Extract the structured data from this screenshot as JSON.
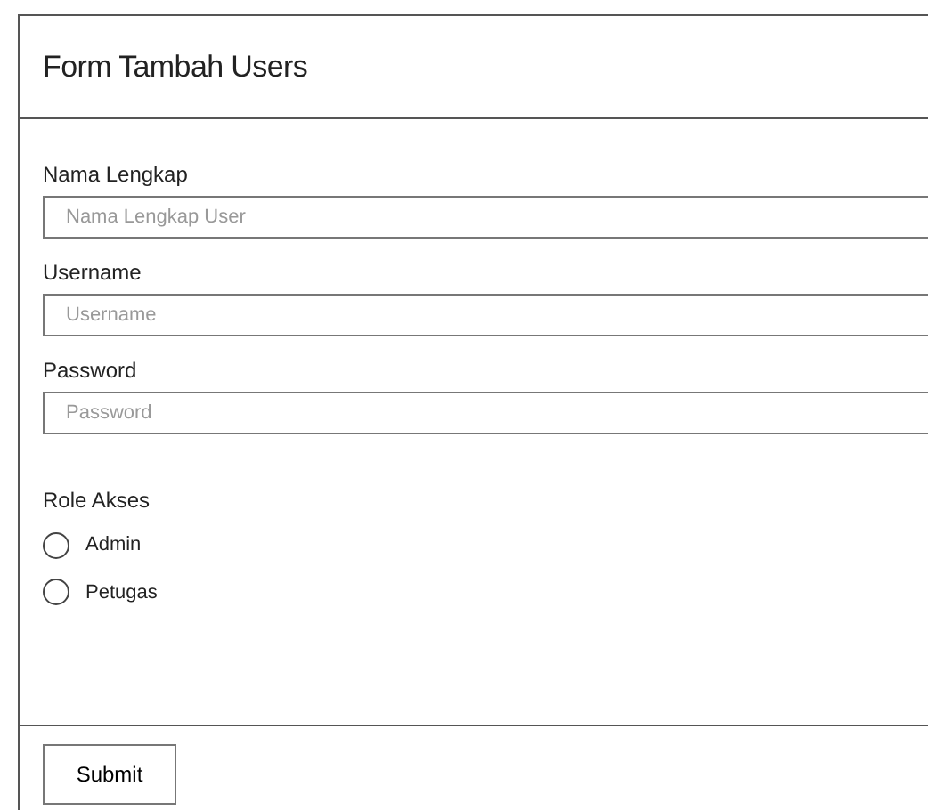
{
  "title": "Form Tambah Users",
  "fields": [
    {
      "label": "Nama Lengkap",
      "placeholder": "Nama Lengkap User"
    },
    {
      "label": "Username",
      "placeholder": "Username"
    },
    {
      "label": "Password",
      "placeholder": "Password"
    }
  ],
  "role": {
    "label": "Role Akses",
    "options": [
      {
        "label": "Admin",
        "selected": false
      },
      {
        "label": "Petugas",
        "selected": false
      }
    ]
  },
  "submit": "Submit"
}
